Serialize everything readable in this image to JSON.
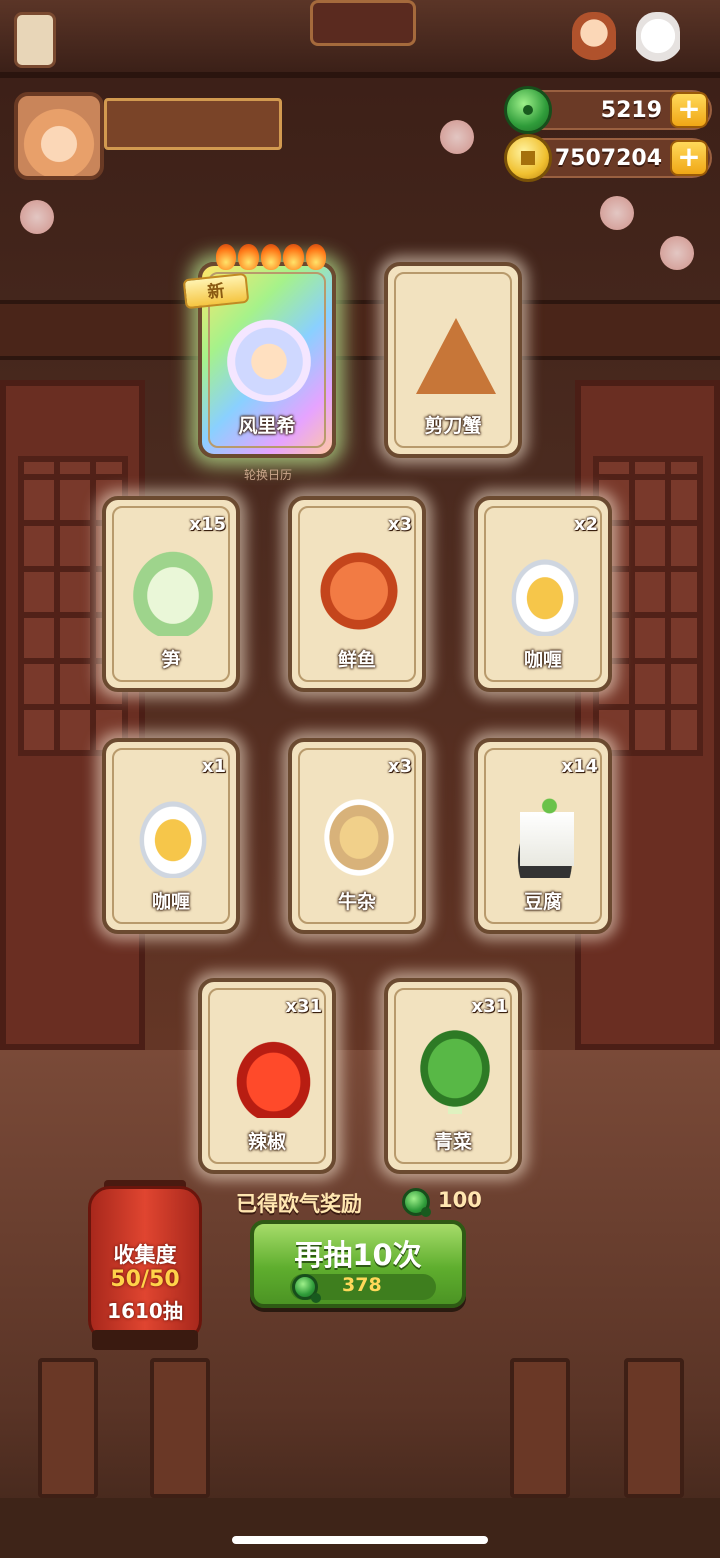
{
  "currencies": {
    "jade": {
      "value": "5219",
      "icon": "jade-icon"
    },
    "coin": {
      "value": "7507204",
      "icon": "coin-icon"
    }
  },
  "highlight_row": [
    {
      "name": "风里希",
      "count": "",
      "badge": "新",
      "stars": 5,
      "rarity": "rainbow",
      "icon": "character-portrait"
    },
    {
      "name": "剪刀蟹",
      "count": "",
      "icon": "scissor-crab-icon"
    }
  ],
  "calendar_label": "轮换日历",
  "cards": [
    {
      "name": "笋",
      "count": "x15",
      "icon": "bamboo-shoot-icon"
    },
    {
      "name": "鲜鱼",
      "count": "x3",
      "icon": "fish-icon"
    },
    {
      "name": "咖喱",
      "count": "x2",
      "icon": "curry-icon"
    },
    {
      "name": "咖喱",
      "count": "x1",
      "icon": "curry-icon"
    },
    {
      "name": "牛杂",
      "count": "x3",
      "icon": "beef-offal-icon"
    },
    {
      "name": "豆腐",
      "count": "x14",
      "icon": "tofu-icon"
    },
    {
      "name": "辣椒",
      "count": "x31",
      "icon": "chili-icon"
    },
    {
      "name": "青菜",
      "count": "x31",
      "icon": "greens-icon"
    }
  ],
  "reward": {
    "label": "已得欧气奖励",
    "value": "100"
  },
  "draw_button": {
    "title": "再抽10次",
    "cost": "378"
  },
  "collection": {
    "label": "收集度",
    "progress": "50/50",
    "draws": "1610抽"
  },
  "colors": {
    "accent_green": "#5fae2e",
    "gold": "#f0c030",
    "lantern_red": "#e04530"
  }
}
